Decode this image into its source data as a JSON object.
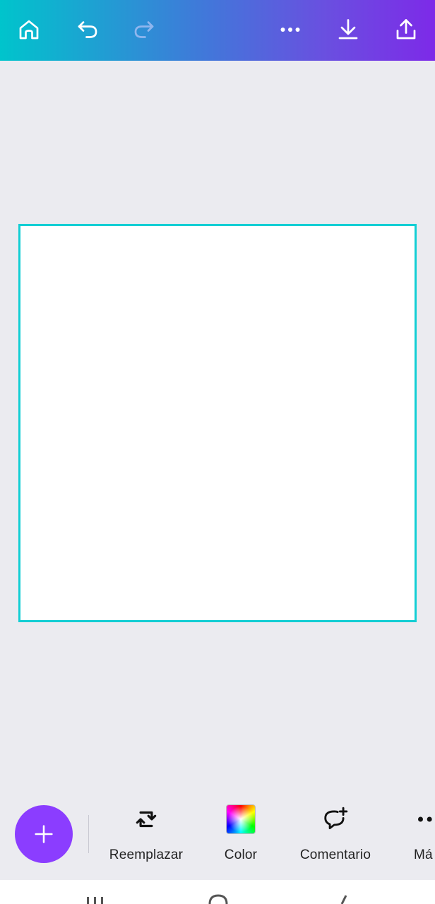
{
  "topbar": {
    "icons": [
      "home-icon",
      "undo-icon",
      "redo-icon",
      "more-icon",
      "download-icon",
      "share-icon"
    ],
    "gradient": [
      "#00c4cc",
      "#7d2ae8"
    ]
  },
  "canvas": {
    "page_background": "#ffffff",
    "selection_color": "#13ced4"
  },
  "toolbar": {
    "fab_color": "#8b3dff",
    "items": [
      {
        "label": "Reemplazar",
        "icon": "replace-icon"
      },
      {
        "label": "Color",
        "icon": "color-swatch-icon"
      },
      {
        "label": "Comentario",
        "icon": "comment-add-icon"
      },
      {
        "label": "Má",
        "icon": "more-icon"
      }
    ]
  },
  "navbar": {
    "icons": [
      "recents-icon",
      "home-circle-icon",
      "back-icon"
    ]
  }
}
